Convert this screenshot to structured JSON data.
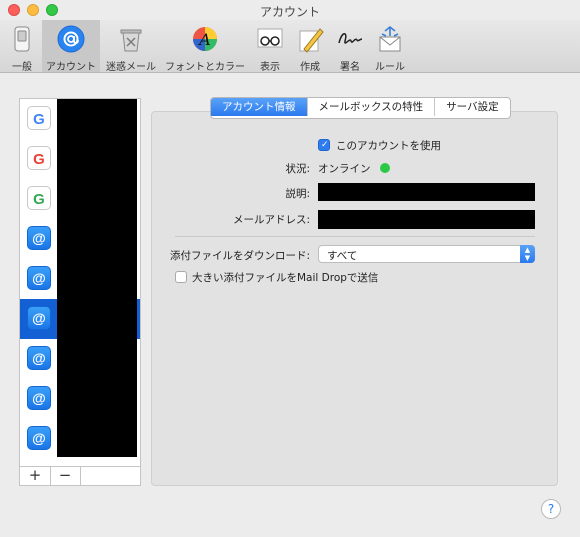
{
  "window": {
    "title": "アカウント"
  },
  "toolbar": {
    "items": [
      {
        "label": "一般",
        "icon": "switch-icon"
      },
      {
        "label": "アカウント",
        "icon": "at-sign-icon"
      },
      {
        "label": "迷惑メール",
        "icon": "trash-bin-icon"
      },
      {
        "label": "フォントとカラー",
        "icon": "font-color-icon"
      },
      {
        "label": "表示",
        "icon": "glasses-icon"
      },
      {
        "label": "作成",
        "icon": "pencil-note-icon"
      },
      {
        "label": "署名",
        "icon": "signature-icon"
      },
      {
        "label": "ルール",
        "icon": "rules-envelope-icon"
      }
    ]
  },
  "sidebar": {
    "accounts": [
      {
        "type": "google"
      },
      {
        "type": "google"
      },
      {
        "type": "google"
      },
      {
        "type": "at"
      },
      {
        "type": "at"
      },
      {
        "type": "at",
        "selected": true
      },
      {
        "type": "at"
      },
      {
        "type": "at"
      },
      {
        "type": "at"
      }
    ],
    "add_label": "+",
    "remove_label": "−"
  },
  "tabs": [
    "アカウント情報",
    "メールボックスの特性",
    "サーバ設定"
  ],
  "form": {
    "enable_label": "このアカウントを使用",
    "status_label": "状況:",
    "status_value": "オンライン",
    "description_label": "説明:",
    "email_label": "メールアドレス:",
    "download_label": "添付ファイルをダウンロード:",
    "download_value": "すべて",
    "maildrop_label": "大きい添付ファイルをMail Dropで送信"
  },
  "help": {
    "label": "?"
  },
  "colors": {
    "accent": "#2a79ef",
    "online": "#2dc848"
  }
}
